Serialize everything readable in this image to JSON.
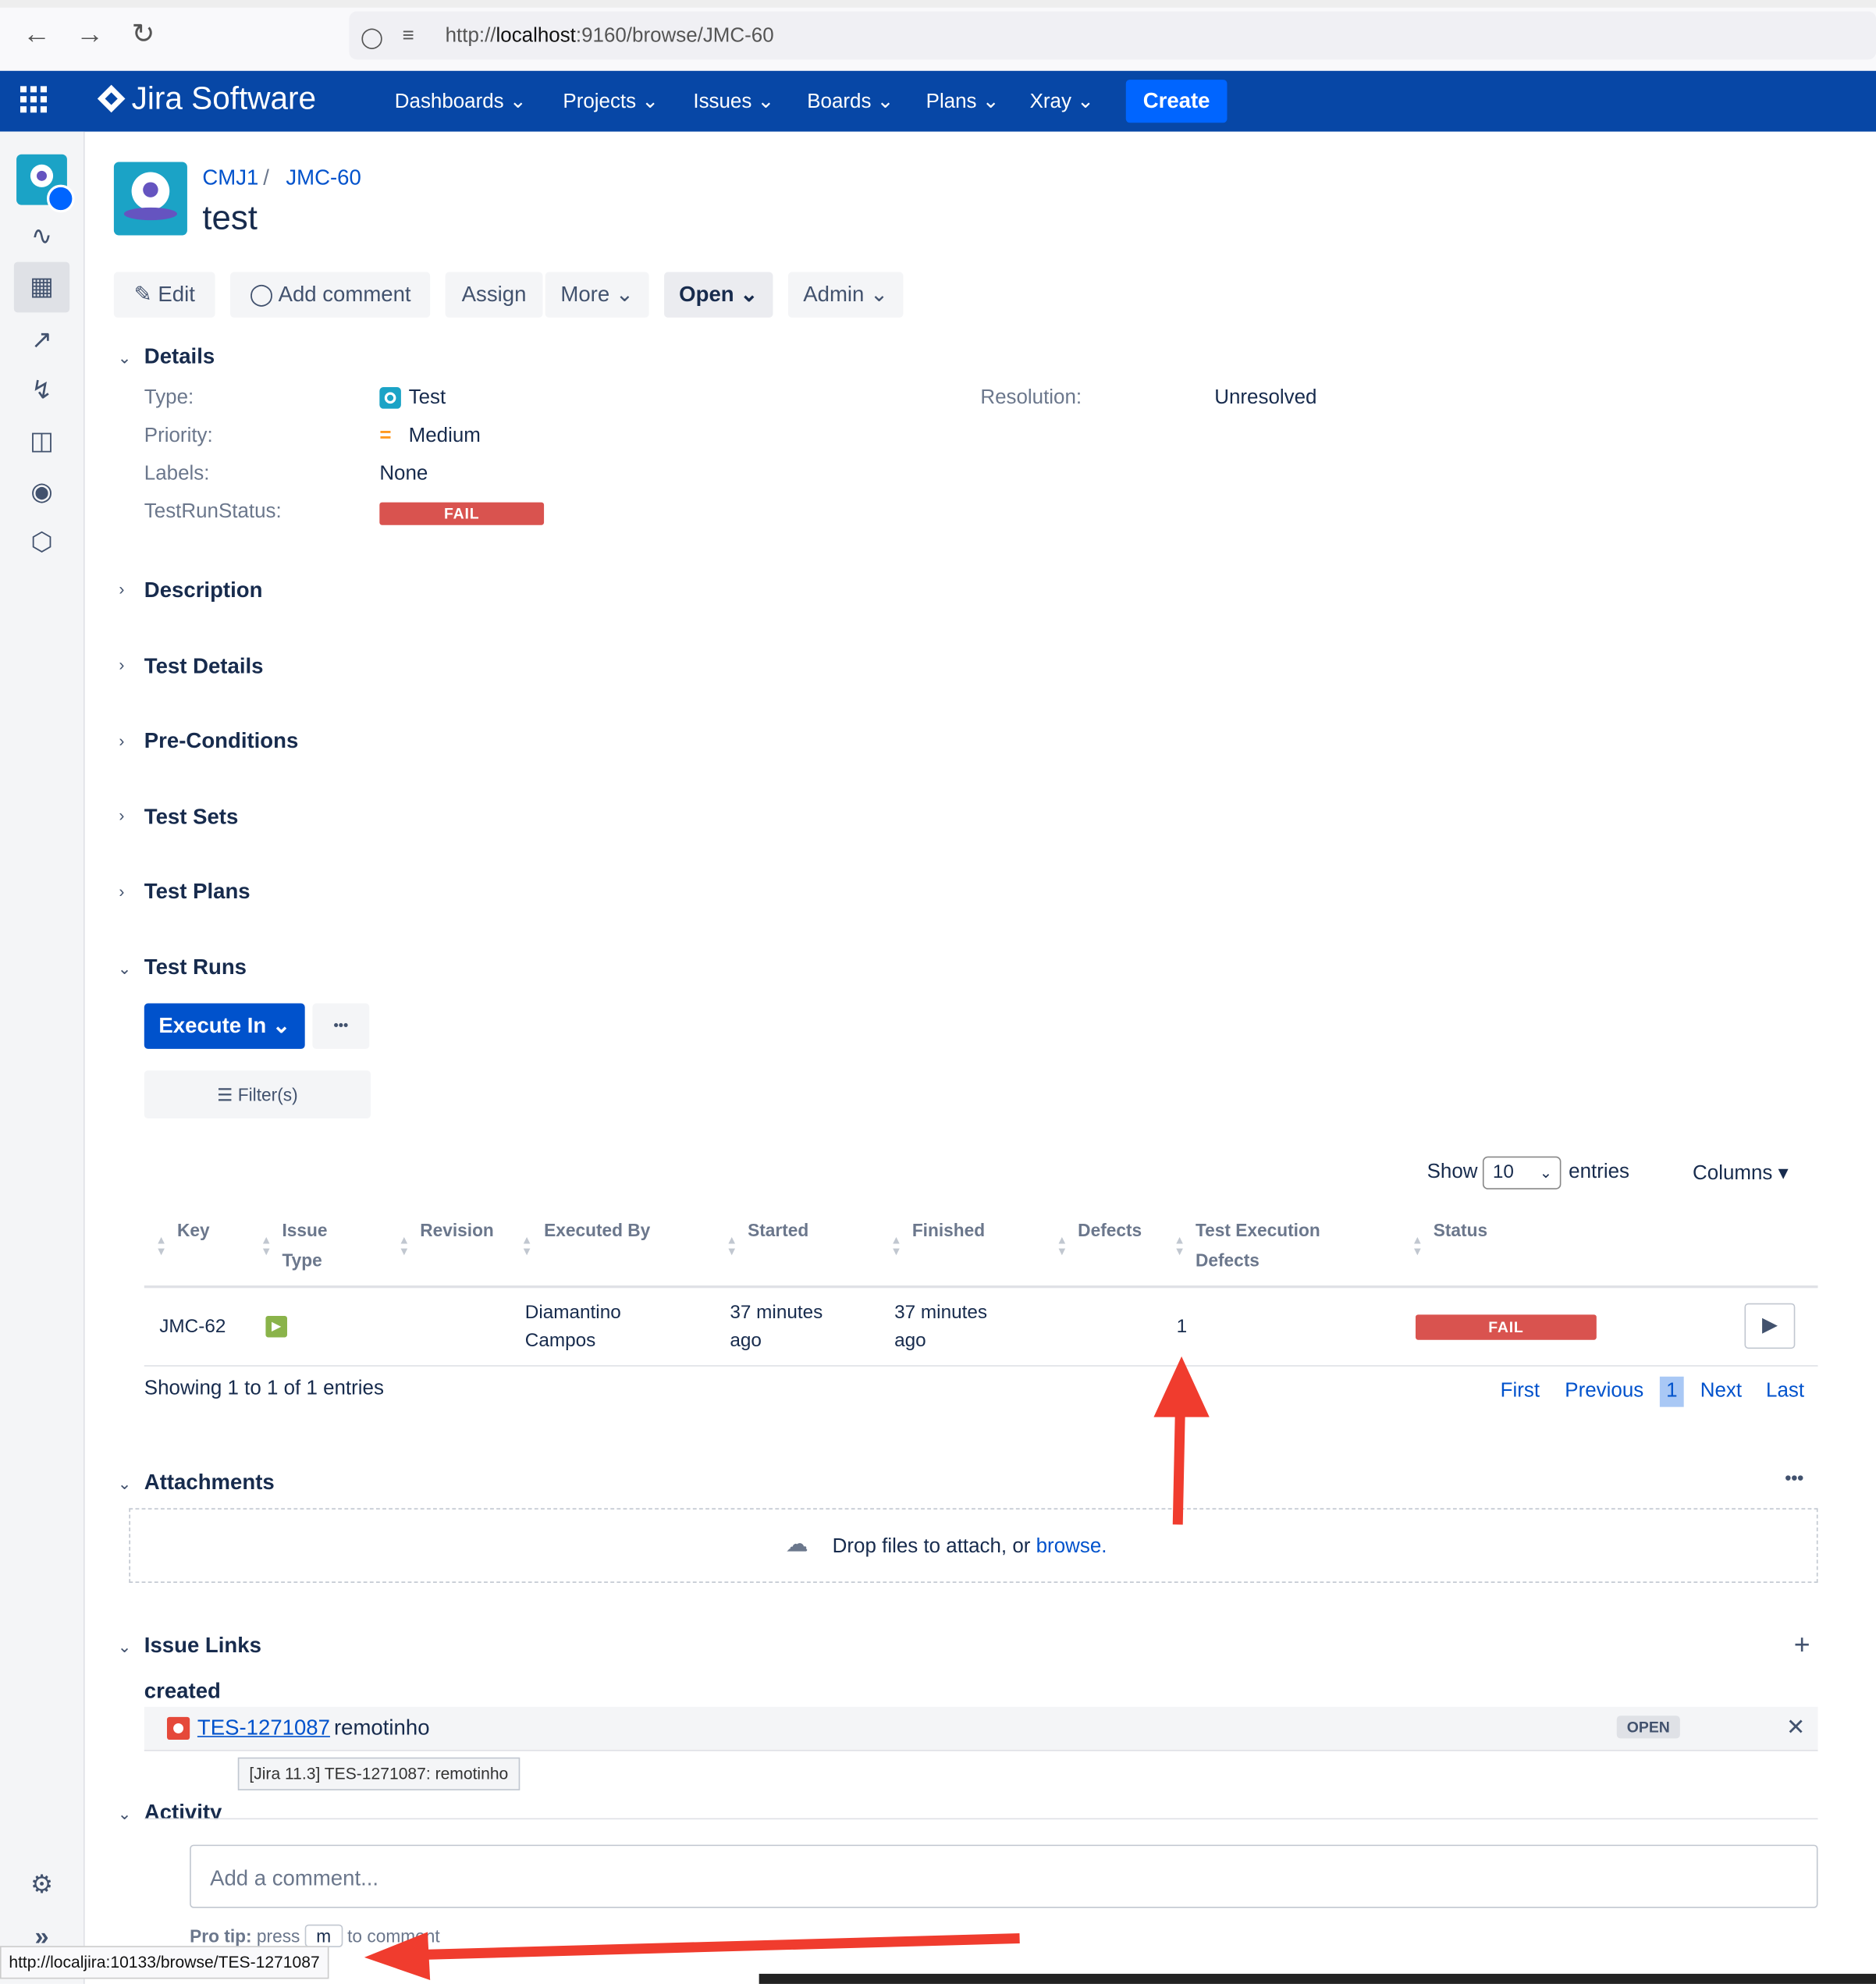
{
  "browser": {
    "url_prefix": "http://",
    "url_host": "localhost",
    "url_rest": ":9160/browse/JMC-60",
    "status_url": "http://localjira:10133/browse/TES-1271087"
  },
  "header": {
    "app_name": "Jira Software",
    "menus": [
      "Dashboards",
      "Projects",
      "Issues",
      "Boards",
      "Plans",
      "Xray"
    ],
    "create_label": "Create"
  },
  "issue": {
    "breadcrumb_project": "CMJ1",
    "breadcrumb_sep": "/",
    "breadcrumb_key": "JMC-60",
    "title": "test"
  },
  "toolbar": {
    "edit": "Edit",
    "add_comment": "Add comment",
    "assign": "Assign",
    "more": "More",
    "open": "Open",
    "admin": "Admin"
  },
  "details": {
    "section": "Details",
    "type_label": "Type:",
    "type_value": "Test",
    "priority_label": "Priority:",
    "priority_value": "Medium",
    "labels_label": "Labels:",
    "labels_value": "None",
    "testrun_label": "TestRunStatus:",
    "testrun_value": "FAIL",
    "resolution_label": "Resolution:",
    "resolution_value": "Unresolved"
  },
  "sections": {
    "description": "Description",
    "test_details": "Test Details",
    "preconditions": "Pre-Conditions",
    "test_sets": "Test Sets",
    "test_plans": "Test Plans",
    "test_runs": "Test Runs",
    "attachments": "Attachments",
    "issue_links": "Issue Links",
    "activity": "Activity"
  },
  "test_runs": {
    "execute_in": "Execute In",
    "more": "•••",
    "filters": "Filter(s)",
    "show": "Show",
    "show_value": "10",
    "entries": "entries",
    "columns": "Columns",
    "headers": {
      "key": "Key",
      "issue_type_1": "Issue",
      "issue_type_2": "Type",
      "revision": "Revision",
      "executed_by": "Executed By",
      "started": "Started",
      "finished": "Finished",
      "defects": "Defects",
      "ted_1": "Test Execution",
      "ted_2": "Defects",
      "status": "Status"
    },
    "row": {
      "key": "JMC-62",
      "executed_by_1": "Diamantino",
      "executed_by_2": "Campos",
      "started_1": "37 minutes",
      "started_2": "ago",
      "finished_1": "37 minutes",
      "finished_2": "ago",
      "defects": "1",
      "status": "FAIL"
    },
    "showing": "Showing 1 to 1 of 1 entries",
    "pager": {
      "first": "First",
      "previous": "Previous",
      "page": "1",
      "next": "Next",
      "last": "Last"
    }
  },
  "attachments": {
    "drop_text": "Drop files to attach, or ",
    "browse": "browse."
  },
  "links": {
    "relation": "created",
    "key": "TES-1271087",
    "summary": "remotinho",
    "status": "OPEN",
    "tooltip": "[Jira 11.3] TES-1271087: remotinho"
  },
  "activity": {
    "comment_placeholder": "Add a comment...",
    "protip_1": "Pro tip:",
    "protip_2": "press",
    "protip_key": "m",
    "protip_3": "to comment"
  },
  "colors": {
    "header_bg": "#0747a6",
    "create_bg": "#0065ff",
    "fail": "#d9534f",
    "link": "#0052cc",
    "annotation_arrow": "#f03c2e"
  }
}
